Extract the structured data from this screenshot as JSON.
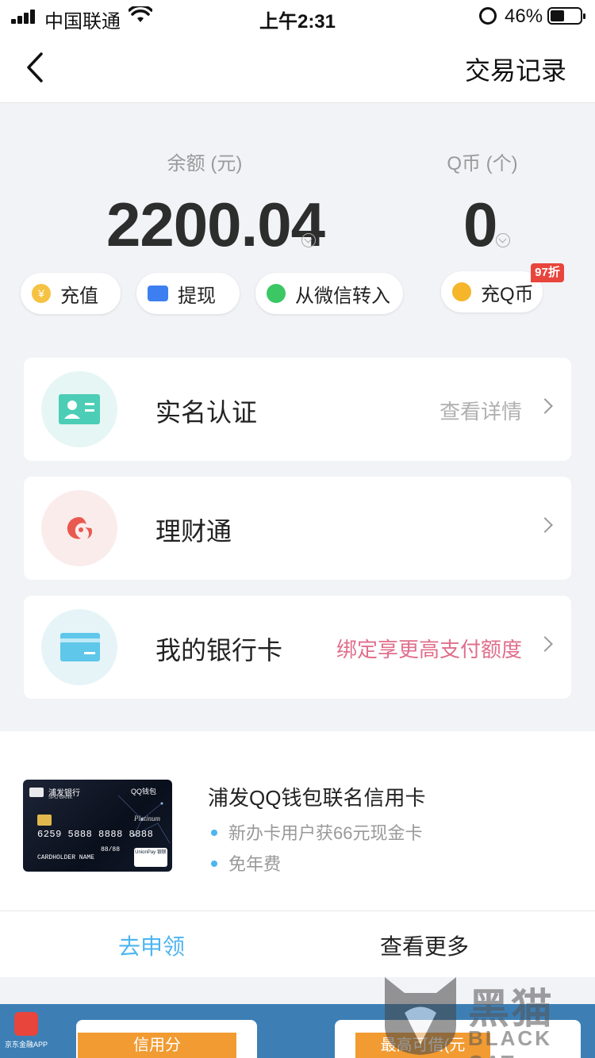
{
  "status_bar": {
    "carrier": "中国联通",
    "time": "上午2:31",
    "battery_percent": "46%",
    "battery_level": 0.46
  },
  "nav": {
    "back_icon": "chevron-left-icon",
    "right_link": "交易记录"
  },
  "balance": {
    "label": "余额 (元)",
    "value": "2200.04"
  },
  "qcoin": {
    "label": "Q币 (个)",
    "value": "0"
  },
  "actions": [
    {
      "label": "充值",
      "icon": "yuan-coin-icon",
      "color": "#f5c242"
    },
    {
      "label": "提现",
      "icon": "wallet-icon",
      "color": "#3d7ff0"
    },
    {
      "label": "从微信转入",
      "icon": "wechat-icon",
      "color": "#3ac764"
    },
    {
      "label": "充Q币",
      "icon": "qcoin-icon",
      "color": "#f5b62b"
    }
  ],
  "discount_badge": "97折",
  "cards": [
    {
      "name": "实名认证",
      "hint": "查看详情",
      "hint_color": "#b0b0b0",
      "icon": "id-card-icon",
      "bg": "#e6f6f4"
    },
    {
      "name": "理财通",
      "hint": "",
      "icon": "licaitong-icon",
      "bg": "#fbecec"
    },
    {
      "name": "我的银行卡",
      "hint": "绑定享更高支付额度",
      "hint_color": "#e06f8b",
      "icon": "bank-card-icon",
      "bg": "#e6f4f8"
    }
  ],
  "promo": {
    "title": "浦发QQ钱包联名信用卡",
    "bullets": [
      "新办卡用户获66元现金卡",
      "免年费"
    ],
    "apply_label": "去申领",
    "more_label": "查看更多",
    "card": {
      "bank_name": "浦发银行",
      "bank_name_en": "SPD BANK",
      "brand": "QQ钱包",
      "tier": "Platinum",
      "number": "6259 5888 8888 8888",
      "cardholder": "CARDHOLDER NAME",
      "expiry": "88/88",
      "network": "UnionPay 银联"
    }
  },
  "banner": {
    "app_name": "京东金融APP",
    "left_button": "信用分",
    "right_button": "最高可借(元"
  },
  "watermark": {
    "cn": "黑猫",
    "en": "BLACK CAT"
  }
}
